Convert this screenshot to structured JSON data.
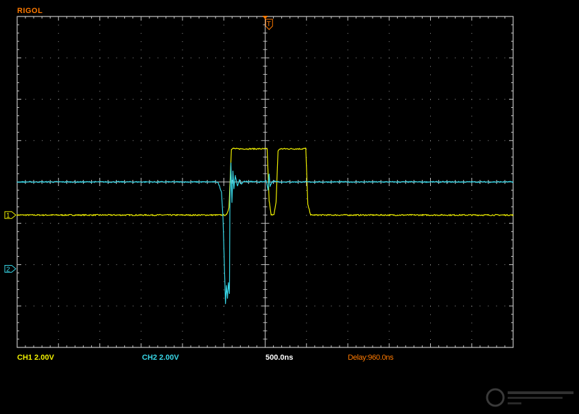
{
  "brand": "RIGOL",
  "trigger_marker": "T",
  "colors": {
    "ch1": "#f0f000",
    "ch2": "#38d8e8",
    "brand": "#ff7a00",
    "delay": "#ff7a00",
    "grid": "#9a9a9a",
    "frame": "#c8c8c8",
    "time": "#ffffff"
  },
  "status": {
    "ch1": "CH1  2.00V",
    "ch2": "CH2  2.00V",
    "timebase": "500.0ns",
    "delay": "Delay:960.0ns"
  },
  "chart_data": {
    "type": "line",
    "title": "",
    "xlabel": "",
    "ylabel": "",
    "grid": true,
    "x_unit": "ns",
    "xlim": [
      -2540,
      2460
    ],
    "ylim": [
      -8,
      8
    ],
    "divisions": {
      "x": 12,
      "y": 8
    },
    "series": [
      {
        "name": "1",
        "x": [
          -2540,
          -430,
          -405,
          -380,
          -360,
          -330,
          -20,
          0,
          20,
          50,
          70,
          90,
          110,
          340,
          370,
          390,
          420,
          2460
        ],
        "y": [
          0.0,
          0.0,
          0.35,
          3.2,
          3.22,
          3.2,
          3.2,
          0.7,
          0.0,
          0.05,
          0.6,
          3.1,
          3.2,
          3.2,
          3.22,
          0.5,
          0.0,
          0.0
        ]
      },
      {
        "name": "2",
        "x": [
          -2540,
          -520,
          -500,
          -480,
          -465,
          -450,
          -440,
          -430,
          -420,
          -410,
          -400,
          -395,
          -385,
          -375,
          -365,
          -355,
          -340,
          -320,
          -300,
          -280,
          -250,
          -220,
          -190,
          -150,
          -100,
          -60,
          -30,
          -10,
          0,
          10,
          30,
          60,
          100,
          2460
        ],
        "y": [
          4.2,
          4.2,
          4.0,
          3.7,
          2.5,
          0.0,
          -1.7,
          -0.8,
          -1.4,
          -0.7,
          -1.2,
          3.4,
          5.1,
          3.2,
          4.7,
          3.9,
          4.5,
          4.0,
          4.3,
          4.1,
          4.25,
          4.2,
          4.22,
          4.2,
          4.2,
          4.2,
          4.25,
          3.8,
          4.6,
          4.0,
          4.2,
          4.25,
          4.2,
          4.2
        ]
      }
    ],
    "channel_offsets": {
      "1": -1.6,
      "2": -4.2
    }
  }
}
